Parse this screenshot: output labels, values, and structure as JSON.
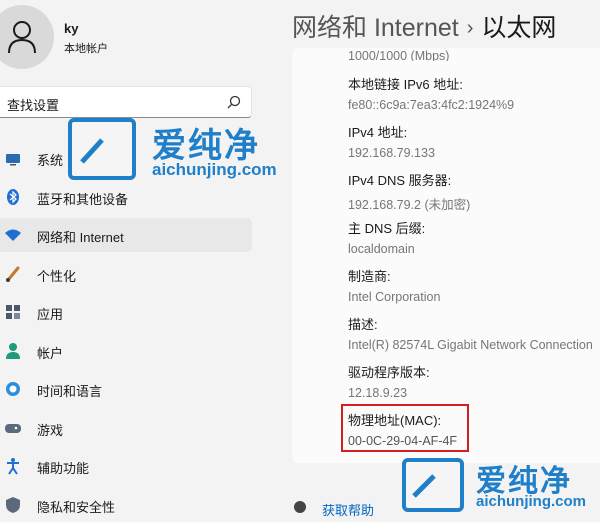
{
  "user": {
    "name": "ky",
    "subtitle": "本地帐户"
  },
  "search": {
    "placeholder": "查找设置"
  },
  "nav": [
    {
      "label": "系统",
      "icon": "display-icon"
    },
    {
      "label": "蓝牙和其他设备",
      "icon": "bluetooth-icon"
    },
    {
      "label": "网络和 Internet",
      "icon": "wifi-icon",
      "active": true
    },
    {
      "label": "个性化",
      "icon": "brush-icon"
    },
    {
      "label": "应用",
      "icon": "apps-icon"
    },
    {
      "label": "帐户",
      "icon": "person-icon"
    },
    {
      "label": "时间和语言",
      "icon": "globe-clock-icon"
    },
    {
      "label": "游戏",
      "icon": "gamepad-icon"
    },
    {
      "label": "辅助功能",
      "icon": "accessibility-icon"
    },
    {
      "label": "隐私和安全性",
      "icon": "shield-icon"
    }
  ],
  "header": {
    "section": "网络和 Internet",
    "page": "以太网"
  },
  "properties": {
    "speed_value": "1000/1000 (Mbps)",
    "ipv6_label": "本地链接 IPv6 地址:",
    "ipv6_value": "fe80::6c9a:7ea3:4fc2:1924%9",
    "ipv4_label": "IPv4 地址:",
    "ipv4_value": "192.168.79.133",
    "dns_label": "IPv4 DNS 服务器:",
    "dns_value": "192.168.79.2 (未加密)",
    "dns_suffix_label": "主 DNS 后缀:",
    "dns_suffix_value": "localdomain",
    "manufacturer_label": "制造商:",
    "manufacturer_value": "Intel Corporation",
    "description_label": "描述:",
    "description_value": "Intel(R) 82574L Gigabit Network Connection",
    "driver_label": "驱动程序版本:",
    "driver_value": "12.18.9.23",
    "mac_label": "物理地址(MAC):",
    "mac_value": "00-0C-29-04-AF-4F"
  },
  "help": {
    "label": "获取帮助"
  },
  "watermark": {
    "brand": "爱纯净",
    "url": "aichunjing.com"
  },
  "colors": {
    "accent": "#0067c0",
    "highlight": "#d21f1f",
    "watermark": "#1f7fc9"
  }
}
